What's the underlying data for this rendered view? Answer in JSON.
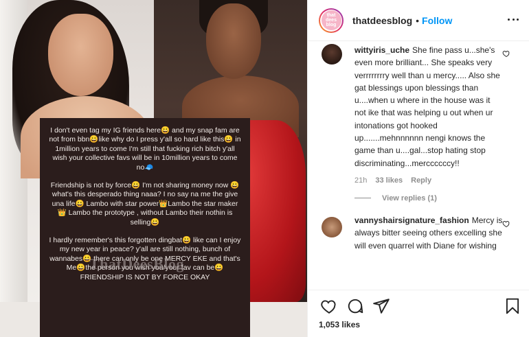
{
  "post": {
    "username": "thatdeesblog",
    "follow_label": "Follow",
    "avatar_text": "that dees blog",
    "likes": "1,053 likes"
  },
  "image": {
    "card_paragraphs": [
      "I don't even tag my IG friends here😀 and my snap fam are not from bbn😀like why do I press y'all so hard like this😀 in 1million years to come I'm still that fucking rich bitch y'all wish your collective favs will be in 10million years to come no🧢",
      "Friendship is not by force😀 I'm not sharing money now 😀what's this desperado thing naaa? I no say na me the give una life😀 Lambo with star power👑Lambo the star maker 👑 Lambo the prototype , without Lambo their nothin is selling😀",
      "I hardly remember's this forgotten dingbat😀 like can I enjoy my new year in peace? y'all are still nothing, bunch of wannabes😀 there can only be one MERCY EKE and that's Me😀the person you wish you/your fav can be😀 FRIENDSHIP IS NOT BY FORCE OKAY"
    ],
    "watermark": "ThatDeesBlog"
  },
  "comments": [
    {
      "user": "wittyiris_uche",
      "text": "She fine pass u...she's even more brilliant... She speaks very verrrrrrrry well than u mercy..... Also she gat blessings upon blessings than u....when u where in the house was it not ike that was helping u out when ur intonations got hooked up.......mehnnnnnn nengi knows the game than u....gal...stop hating stop discriminating...merccccccy!!",
      "time": "21h",
      "likes": "33 likes",
      "reply": "Reply",
      "view_replies": "View replies (1)"
    },
    {
      "user": "vannyshairsignature_fashion",
      "text": "Mercy is always bitter seeing others excelling she will even quarrel with Diane for wishing"
    }
  ],
  "icons": [
    "more-options-icon",
    "heart-icon",
    "comment-icon",
    "share-icon",
    "bookmark-icon"
  ],
  "colors": {
    "accent": "#0095f6",
    "text": "#262626",
    "muted": "#8e8e8e",
    "border": "#efefef"
  }
}
